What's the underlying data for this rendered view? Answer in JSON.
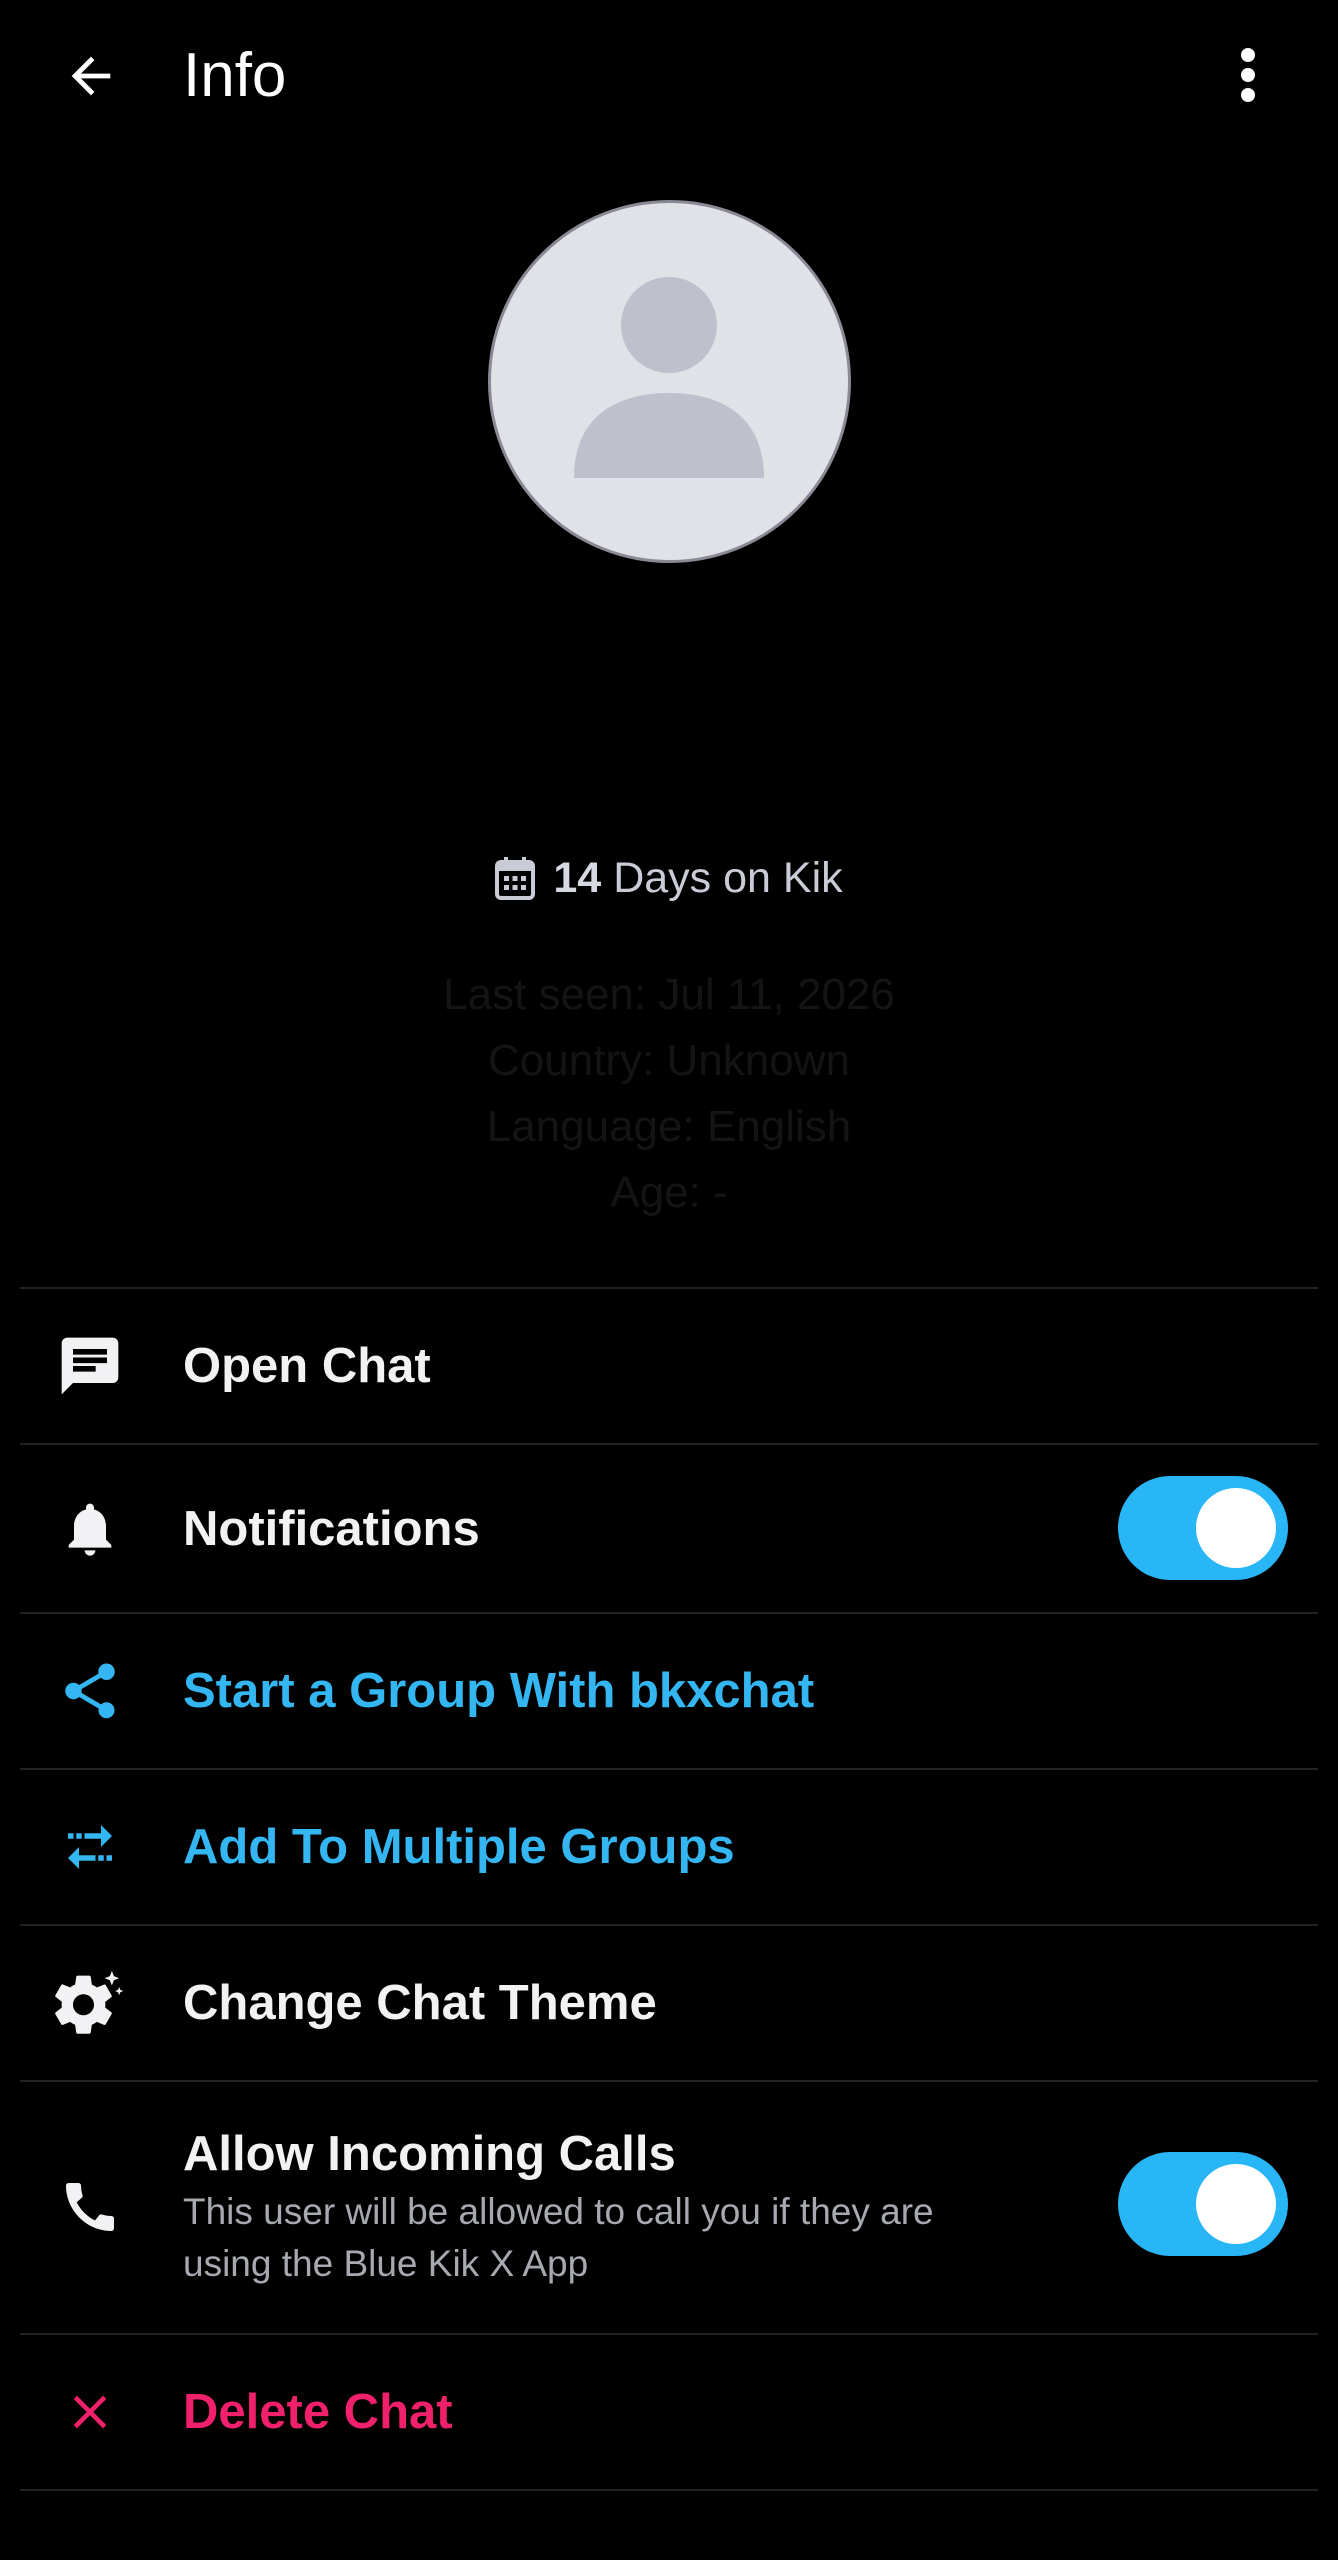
{
  "header": {
    "title": "Info",
    "back_icon": "arrow-left-icon",
    "more_icon": "more-vert-icon"
  },
  "profile": {
    "avatar_icon": "person-placeholder-icon",
    "days_count": "14",
    "days_suffix": "Days on Kik",
    "last_seen": "Last seen: Jul 11, 2026",
    "country": "Country: Unknown",
    "language": "Language: English",
    "age": "Age: -"
  },
  "menu": {
    "open_chat": {
      "label": "Open Chat",
      "icon": "chat-icon"
    },
    "notifications": {
      "label": "Notifications",
      "icon": "bell-icon",
      "enabled": true
    },
    "start_group": {
      "label": "Start a Group With bkxchat",
      "icon": "share-icon"
    },
    "add_groups": {
      "label": "Add To Multiple Groups",
      "icon": "swap-arrows-icon"
    },
    "chat_theme": {
      "label": "Change Chat Theme",
      "icon": "gear-sparkle-icon"
    },
    "incoming_calls": {
      "label": "Allow Incoming Calls",
      "sub_line1": "This user will be allowed to call you if they are",
      "sub_line2": "using the Blue Kik X App",
      "icon": "phone-icon",
      "enabled": true
    },
    "delete_chat": {
      "label": "Delete Chat",
      "icon": "close-icon"
    }
  },
  "colors": {
    "accent": "#29b6f6",
    "link": "#33b6f1",
    "danger": "#f0206c",
    "background": "#000000"
  }
}
